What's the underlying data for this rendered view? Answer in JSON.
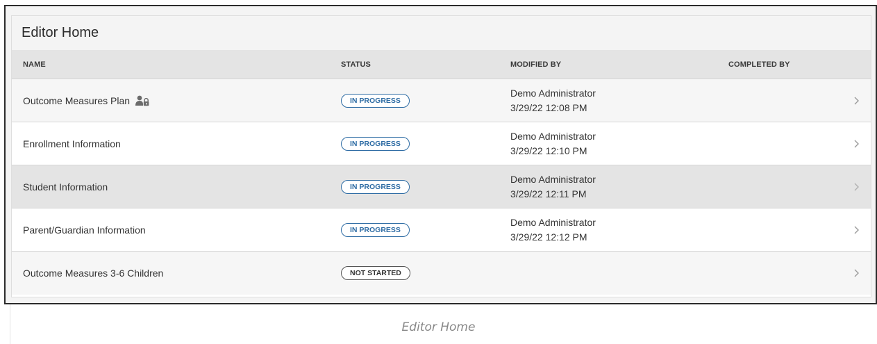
{
  "panel": {
    "title": "Editor Home"
  },
  "columns": {
    "name": "NAME",
    "status": "STATUS",
    "modified_by": "MODIFIED BY",
    "completed_by": "COMPLETED BY"
  },
  "rows": [
    {
      "name": "Outcome Measures Plan",
      "status": "IN PROGRESS",
      "modified_name": "Demo Administrator",
      "modified_time": "3/29/22 12:08 PM",
      "completed_by": "",
      "icon": "user-lock-icon"
    },
    {
      "name": "Enrollment Information",
      "status": "IN PROGRESS",
      "modified_name": "Demo Administrator",
      "modified_time": "3/29/22 12:10 PM",
      "completed_by": ""
    },
    {
      "name": "Student Information",
      "status": "IN PROGRESS",
      "modified_name": "Demo Administrator",
      "modified_time": "3/29/22 12:11 PM",
      "completed_by": ""
    },
    {
      "name": "Parent/Guardian Information",
      "status": "IN PROGRESS",
      "modified_name": "Demo Administrator",
      "modified_time": "3/29/22 12:12 PM",
      "completed_by": ""
    },
    {
      "name": "Outcome Measures 3-6 Children",
      "status": "NOT STARTED",
      "modified_name": "",
      "modified_time": "",
      "completed_by": ""
    }
  ],
  "caption": "Editor Home",
  "colors": {
    "in_progress": "#2e6ca4",
    "not_started": "#333333"
  }
}
